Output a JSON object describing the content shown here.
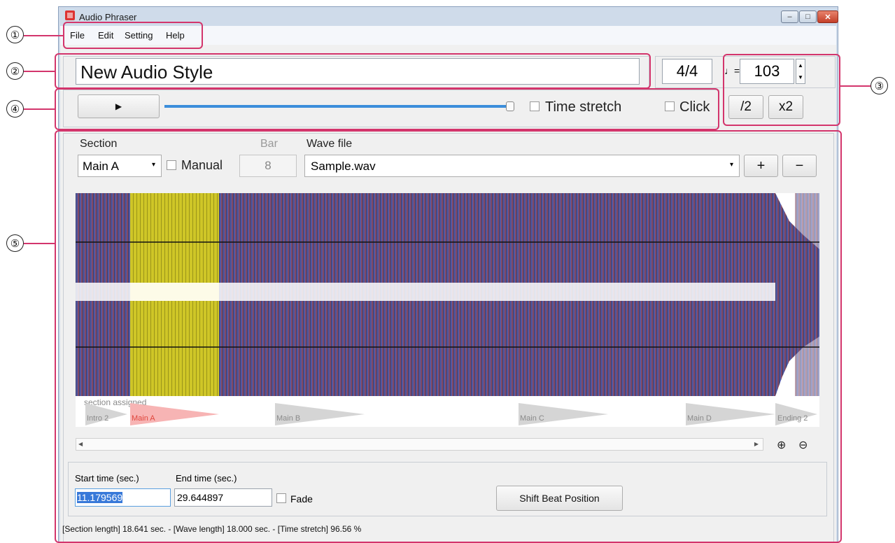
{
  "window": {
    "title": "Audio Phraser",
    "controls": {
      "minimize": "–",
      "maximize": "□",
      "close": "✕"
    }
  },
  "menu": [
    "File",
    "Edit",
    "Setting",
    "Help"
  ],
  "callouts": [
    "①",
    "②",
    "③",
    "④",
    "⑤"
  ],
  "style_name": "New Audio Style",
  "time_signature": "4/4",
  "tempo": {
    "note_icon": "♩=",
    "value": "103",
    "up": "▲",
    "down": "▼"
  },
  "tempo_buttons": {
    "half": "/2",
    "double": "x2"
  },
  "transport": {
    "play_icon": "▶",
    "position": 1.0,
    "time_stretch_label": "Time stretch",
    "click_label": "Click"
  },
  "section_panel": {
    "section_label": "Section",
    "section_value": "Main A",
    "manual_label": "Manual",
    "bar_label": "Bar",
    "bar_value": "8",
    "wave_file_label": "Wave file",
    "wave_file_value": "Sample.wav",
    "add_button": "+",
    "remove_button": "−",
    "dropdown_arrow": "▾"
  },
  "section_track": {
    "assigned_caption": "section assigned",
    "sections": [
      "Intro 2",
      "Main A",
      "Main B",
      "Main C",
      "Main D",
      "Ending 2"
    ]
  },
  "scroll": {
    "left": "◀",
    "right": "▶",
    "zoom_in": "⊕",
    "zoom_out": "⊖"
  },
  "timing": {
    "start_label": "Start time (sec.)",
    "start_value": "11.179569",
    "end_label": "End time (sec.)",
    "end_value": "29.644897",
    "fade_label": "Fade",
    "shift_button": "Shift Beat Position"
  },
  "status_bar": "[Section length] 18.641 sec. - [Wave length] 18.000 sec. - [Time stretch] 96.56 %",
  "colors": {
    "accent": "#d3356c",
    "waveform_dark": "#3b3d6e",
    "selection": "#cfc627",
    "slider": "#3c8edb"
  }
}
